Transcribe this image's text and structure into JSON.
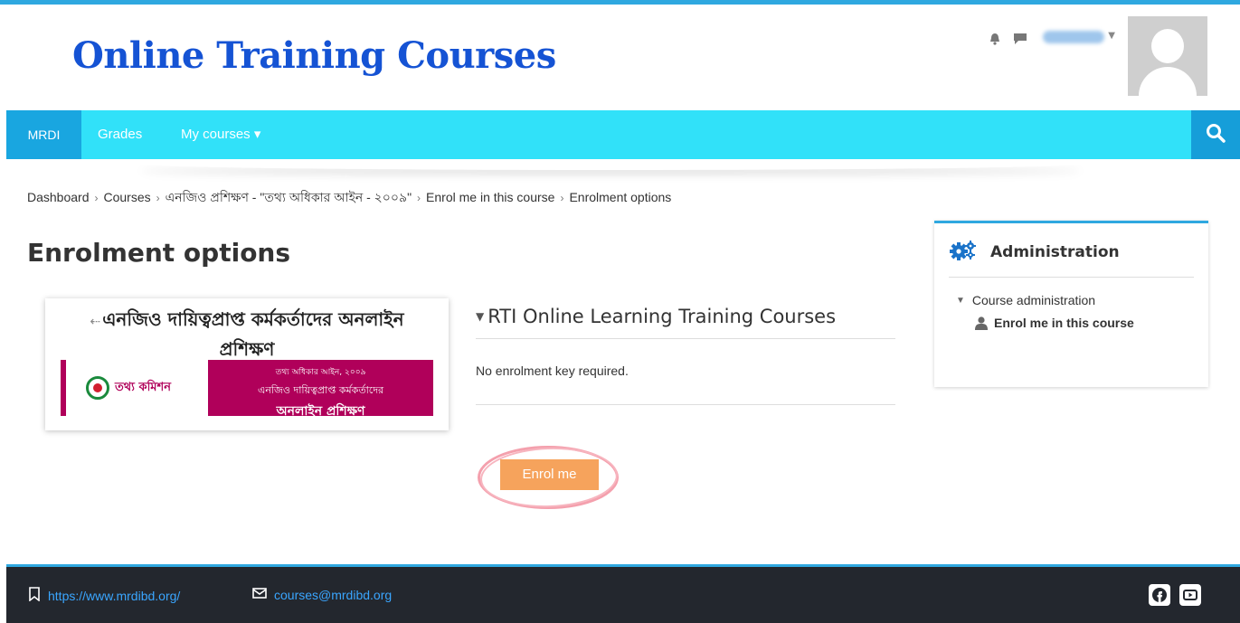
{
  "header": {
    "site_title": "Online Training Courses"
  },
  "navbar": {
    "items": [
      {
        "label": "MRDI"
      },
      {
        "label": "Grades"
      },
      {
        "label": "My courses ▾"
      }
    ]
  },
  "breadcrumb": {
    "items": [
      "Dashboard",
      "Courses",
      "এনজিও প্রশিক্ষণ - \"তথ্য অধিকার আইন - ২০০৯\"",
      "Enrol me in this course",
      "Enrolment options"
    ],
    "separator": "›"
  },
  "page": {
    "title": "Enrolment options"
  },
  "course_card": {
    "title": "এনজিও দায়িত্বপ্রাপ্ত কর্মকর্তাদের অনলাইন প্রশিক্ষণ",
    "banner": {
      "logo_text": "তথ্য কমিশন",
      "line1": "তথ্য অধিকার আইন, ২০০৯",
      "line2": "এনজিও দায়িত্বপ্রাপ্ত কর্মকর্তাদের",
      "line3": "অনলাইন প্রশিক্ষণ"
    }
  },
  "enrol": {
    "section_title": "RTI Online Learning Training Courses",
    "no_key_text": "No enrolment key required.",
    "button_label": "Enrol me"
  },
  "admin": {
    "title": "Administration",
    "tree": {
      "parent": "Course administration",
      "child": "Enrol me in this course"
    }
  },
  "footer": {
    "website": "https://www.mrdibd.org/",
    "email": "courses@mrdibd.org"
  },
  "colors": {
    "nav_bg": "#31e1f9",
    "nav_active": "#19a6e0",
    "title_blue": "#1553d4",
    "enrol_button": "#f6a35c",
    "footer_bg": "#23272e",
    "banner_magenta": "#b0005a"
  },
  "icons": {
    "notifications": "bell-icon",
    "messages": "chat-icon",
    "search": "search-icon",
    "admin": "gears-icon",
    "website": "bookmark-icon",
    "email": "envelope-icon",
    "facebook": "facebook-icon",
    "youtube": "youtube-icon"
  }
}
